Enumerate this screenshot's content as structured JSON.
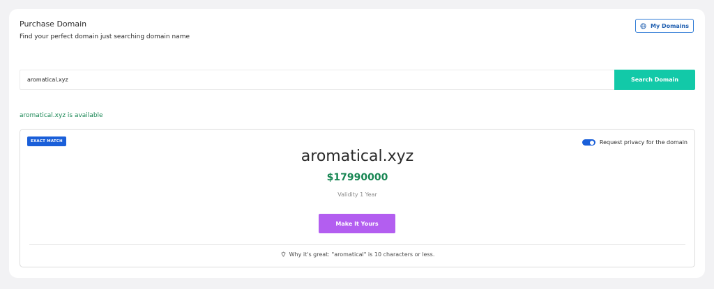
{
  "header": {
    "title": "Purchase Domain",
    "subtitle": "Find your perfect domain just searching domain name",
    "my_domains_label": "My Domains",
    "my_domains_icon": "globe-icon"
  },
  "search": {
    "value": "aromatical.xyz",
    "button_label": "Search Domain"
  },
  "availability": {
    "text": "aromatical.xyz is available"
  },
  "result": {
    "badge": "EXACT MATCH",
    "privacy_label": "Request privacy for the domain",
    "privacy_enabled": true,
    "domain": "aromatical.xyz",
    "price": "$17990000",
    "validity": "Validity 1 Year",
    "action_label": "Make It Yours",
    "why_text": "Why it's great: \"aromatical\" is 10 characters or less.",
    "why_icon": "lightbulb-icon"
  },
  "colors": {
    "accent_green": "#12c9a8",
    "success_text": "#198754",
    "primary_blue": "#1a5fd9",
    "action_purple": "#b35ef0"
  }
}
